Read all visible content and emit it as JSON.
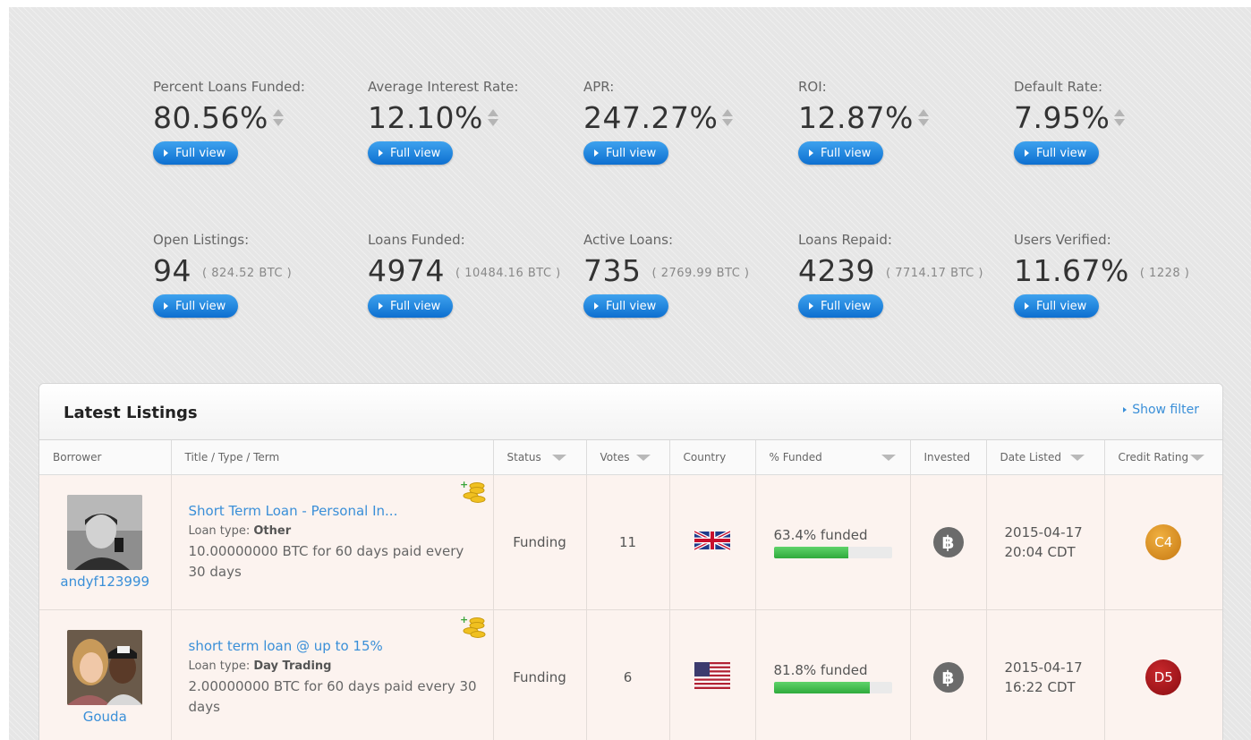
{
  "stats_row1": [
    {
      "label": "Percent Loans Funded:",
      "value": "80.56%",
      "button": "Full view"
    },
    {
      "label": "Average Interest Rate:",
      "value": "12.10%",
      "button": "Full view"
    },
    {
      "label": "APR:",
      "value": "247.27%",
      "button": "Full view"
    },
    {
      "label": "ROI:",
      "value": "12.87%",
      "button": "Full view"
    },
    {
      "label": "Default Rate:",
      "value": "7.95%",
      "button": "Full view"
    }
  ],
  "stats_row2": [
    {
      "label": "Open Listings:",
      "value": "94",
      "sub": "( 824.52 BTC )",
      "button": "Full view"
    },
    {
      "label": "Loans Funded:",
      "value": "4974",
      "sub": "( 10484.16 BTC )",
      "button": "Full view"
    },
    {
      "label": "Active Loans:",
      "value": "735",
      "sub": "( 2769.99 BTC )",
      "button": "Full view"
    },
    {
      "label": "Loans Repaid:",
      "value": "4239",
      "sub": "( 7714.17 BTC )",
      "button": "Full view"
    },
    {
      "label": "Users Verified:",
      "value": "11.67%",
      "sub": "( 1228 )",
      "button": "Full view"
    }
  ],
  "listings": {
    "title": "Latest Listings",
    "show_filter": "Show filter",
    "columns": [
      "Borrower",
      "Title / Type / Term",
      "Status",
      "Votes",
      "Country",
      "% Funded",
      "Invested",
      "Date Listed",
      "Credit Rating"
    ],
    "rows": [
      {
        "username": "andyf123999",
        "title": "Short Term Loan - Personal In...",
        "type_label": "Loan type: ",
        "type": "Other",
        "desc": "10.00000000 BTC for 60 days paid every 30 days",
        "status": "Funding",
        "votes": "11",
        "country": "uk-flag",
        "funded_text": "63.4% funded",
        "funded_pct": 63.4,
        "invested_icon": "bitcoin-icon",
        "date": "2015-04-17",
        "time": "20:04 CDT",
        "rating": "C4",
        "rating_color": "#d98a1a"
      },
      {
        "username": "Gouda",
        "title": "short term loan @ up to 15%",
        "type_label": "Loan type: ",
        "type": "Day Trading",
        "desc": "2.00000000 BTC for 60 days paid every 30 days",
        "status": "Funding",
        "votes": "6",
        "country": "us-flag",
        "funded_text": "81.8% funded",
        "funded_pct": 81.8,
        "invested_icon": "bitcoin-icon",
        "date": "2015-04-17",
        "time": "16:22 CDT",
        "rating": "D5",
        "rating_color": "#a3141a"
      }
    ]
  }
}
